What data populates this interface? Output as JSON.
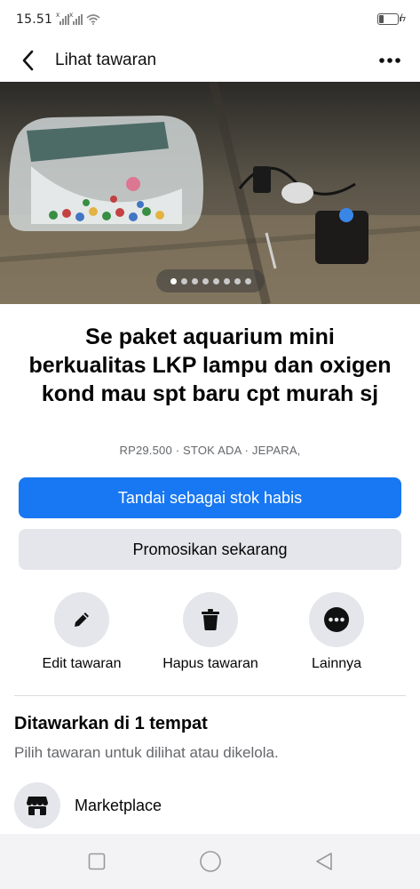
{
  "status_bar": {
    "time": "15.51"
  },
  "header": {
    "title": "Lihat tawaran"
  },
  "gallery": {
    "photo_count": 8,
    "active_index": 0
  },
  "listing": {
    "title": "Se paket aquarium mini berkualitas LKP lampu dan oxigen kond mau spt baru cpt murah sj",
    "meta": "RP29.500 · STOK ADA · JEPARA,"
  },
  "buttons": {
    "mark_sold": "Tandai sebagai stok habis",
    "promote": "Promosikan sekarang"
  },
  "actions": [
    {
      "label": "Edit tawaran",
      "icon": "pencil-icon"
    },
    {
      "label": "Hapus tawaran",
      "icon": "trash-icon"
    },
    {
      "label": "Lainnya",
      "icon": "more-dots-icon"
    }
  ],
  "section": {
    "title": "Ditawarkan di 1 tempat",
    "subtitle": "Pilih tawaran untuk dilihat atau dikelola."
  },
  "places": [
    {
      "label": "Marketplace",
      "icon": "marketplace-shop-icon"
    }
  ],
  "colors": {
    "primary": "#1877f2",
    "secondary_bg": "#e4e6eb",
    "muted_text": "#65676b"
  }
}
